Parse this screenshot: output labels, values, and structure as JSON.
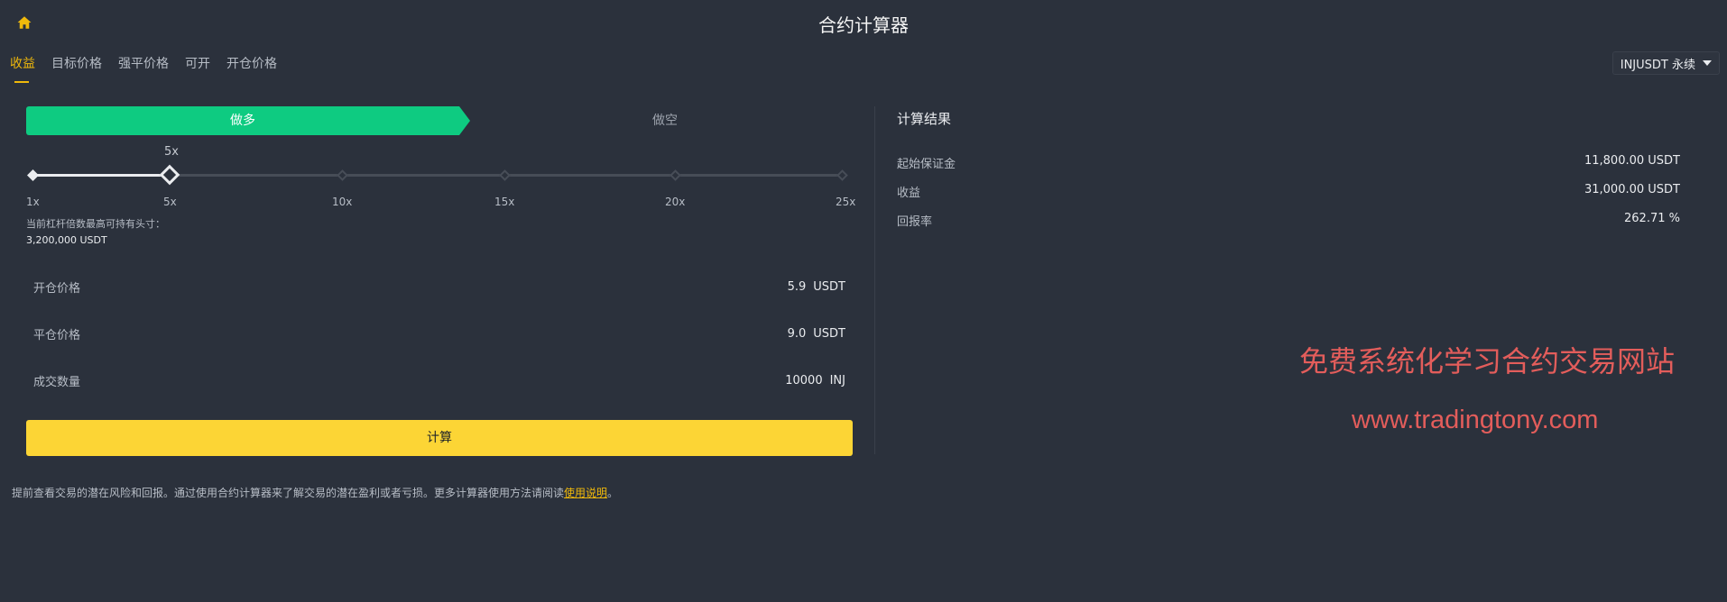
{
  "header": {
    "title": "合约计算器",
    "home_icon": "home-icon"
  },
  "tabs": [
    {
      "label": "收益",
      "active": true
    },
    {
      "label": "目标价格",
      "active": false
    },
    {
      "label": "强平价格",
      "active": false
    },
    {
      "label": "可开",
      "active": false
    },
    {
      "label": "开仓价格",
      "active": false
    }
  ],
  "symbol": {
    "label": "INJUSDT 永续"
  },
  "side": {
    "long_label": "做多",
    "short_label": "做空",
    "selected": "long"
  },
  "leverage": {
    "value_label": "5x",
    "value": 5,
    "min": 1,
    "max": 25,
    "ticks": [
      "1x",
      "5x",
      "10x",
      "15x",
      "20x",
      "25x"
    ]
  },
  "max_position": {
    "label": "当前杠杆倍数最高可持有头寸：",
    "value": "3,200,000 USDT"
  },
  "fields": {
    "entry_price": {
      "label": "开仓价格",
      "value": "5.9",
      "unit": "USDT"
    },
    "exit_price": {
      "label": "平仓价格",
      "value": "9.0",
      "unit": "USDT"
    },
    "quantity": {
      "label": "成交数量",
      "value": "10000",
      "unit": "INJ"
    }
  },
  "calculate_label": "计算",
  "results": {
    "title": "计算结果",
    "initial_margin": {
      "label": "起始保证金",
      "value": "11,800.00 USDT"
    },
    "pnl": {
      "label": "收益",
      "value": "31,000.00 USDT"
    },
    "roe": {
      "label": "回报率",
      "value": "262.71 %"
    }
  },
  "watermark": {
    "line1": "免费系统化学习合约交易网站",
    "line2": "www.tradingtony.com"
  },
  "footer_note": {
    "text": "提前查看交易的潜在风险和回报。通过使用合约计算器来了解交易的潜在盈利或者亏损。更多计算器使用方法请阅读",
    "link": "使用说明",
    "tail": "。"
  },
  "colors": {
    "accent": "#f0b90b",
    "long": "#0ecb81",
    "button": "#fcd535",
    "background": "#2b313c"
  }
}
